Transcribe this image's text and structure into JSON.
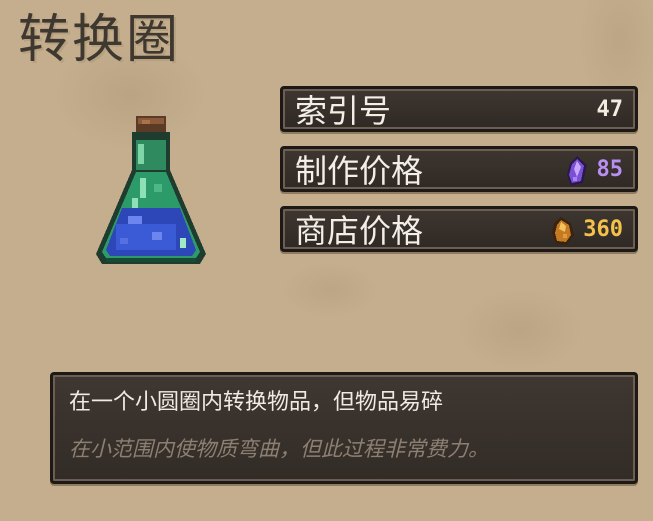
{
  "item": {
    "name": "转换圈",
    "icon": "blue-potion-flask-icon"
  },
  "stats": [
    {
      "label": "索引号",
      "value": "47",
      "icon": "",
      "color": "#f1ece2"
    },
    {
      "label": "制作价格",
      "value": "85",
      "icon": "purple-crystal-icon",
      "color": "#b98ff4"
    },
    {
      "label": "商店价格",
      "value": "360",
      "icon": "gold-nugget-icon",
      "color": "#f4c24a"
    }
  ],
  "description": {
    "main": "在一个小圆圈内转换物品，但物品易碎",
    "flavor": "在小范围内使物质弯曲，但此过程非常费力。"
  }
}
